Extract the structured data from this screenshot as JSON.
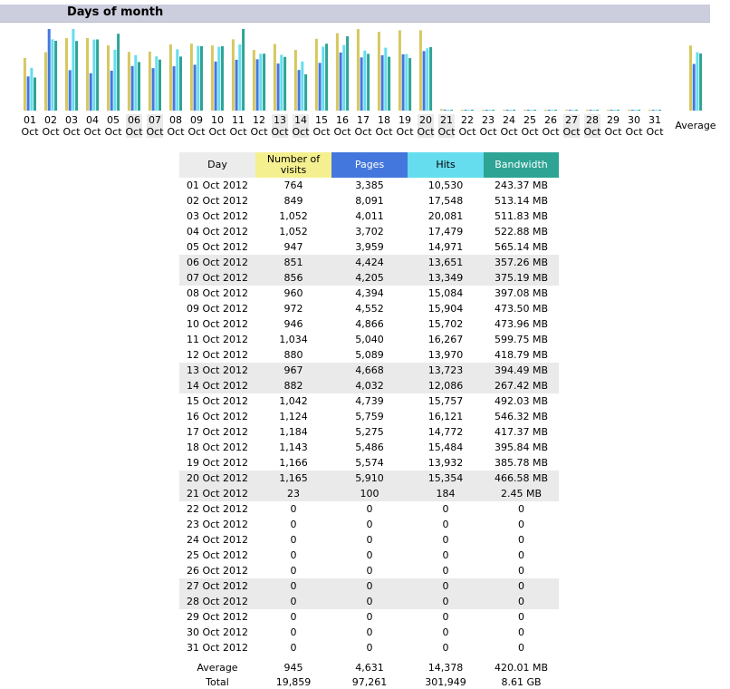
{
  "section": {
    "title": "Days of month"
  },
  "chart_data": {
    "type": "bar",
    "title": "",
    "categories": [
      "01",
      "02",
      "03",
      "04",
      "05",
      "06",
      "07",
      "08",
      "09",
      "10",
      "11",
      "12",
      "13",
      "14",
      "15",
      "16",
      "17",
      "18",
      "19",
      "20",
      "21",
      "22",
      "23",
      "24",
      "25",
      "26",
      "27",
      "28",
      "29",
      "30",
      "31"
    ],
    "category_sublabel": "Oct",
    "weekend_days": [
      "06",
      "07",
      "13",
      "14",
      "20",
      "21",
      "27",
      "28"
    ],
    "average_label": "Average",
    "series": [
      {
        "key": "visits",
        "color": "#d6c860",
        "values": [
          764,
          849,
          1052,
          1052,
          947,
          851,
          856,
          960,
          972,
          946,
          1034,
          880,
          967,
          882,
          1042,
          1124,
          1184,
          1143,
          1166,
          1165,
          23,
          0,
          0,
          0,
          0,
          0,
          0,
          0,
          0,
          0,
          0
        ],
        "average": 945
      },
      {
        "key": "pages",
        "color": "#4477dd",
        "values": [
          3385,
          8091,
          4011,
          3702,
          3959,
          4424,
          4205,
          4394,
          4552,
          4866,
          5040,
          5089,
          4668,
          4032,
          4739,
          5759,
          5275,
          5486,
          5574,
          5910,
          100,
          0,
          0,
          0,
          0,
          0,
          0,
          0,
          0,
          0,
          0
        ],
        "average": 4631
      },
      {
        "key": "hits",
        "color": "#66ddee",
        "values": [
          10530,
          17548,
          20081,
          17479,
          14971,
          13651,
          13349,
          15084,
          15904,
          15702,
          16267,
          13970,
          13723,
          12086,
          15757,
          16121,
          14772,
          15484,
          13932,
          15354,
          184,
          0,
          0,
          0,
          0,
          0,
          0,
          0,
          0,
          0,
          0
        ],
        "average": 14378
      },
      {
        "key": "bandwidth",
        "color": "#2ea495",
        "values": [
          243.37,
          513.14,
          511.83,
          522.88,
          565.14,
          357.26,
          375.19,
          397.08,
          473.5,
          473.96,
          599.75,
          418.79,
          394.49,
          267.42,
          492.03,
          546.32,
          417.37,
          395.84,
          385.78,
          466.58,
          2.45,
          0,
          0,
          0,
          0,
          0,
          0,
          0,
          0,
          0,
          0
        ],
        "average": 420.01
      }
    ]
  },
  "table": {
    "headers": {
      "day": "Day",
      "visits": "Number of visits",
      "pages": "Pages",
      "hits": "Hits",
      "bandwidth": "Bandwidth"
    },
    "rows": [
      {
        "day": "01 Oct 2012",
        "visits": "764",
        "pages": "3,385",
        "hits": "10,530",
        "bandwidth": "243.37 MB",
        "weekend": false
      },
      {
        "day": "02 Oct 2012",
        "visits": "849",
        "pages": "8,091",
        "hits": "17,548",
        "bandwidth": "513.14 MB",
        "weekend": false
      },
      {
        "day": "03 Oct 2012",
        "visits": "1,052",
        "pages": "4,011",
        "hits": "20,081",
        "bandwidth": "511.83 MB",
        "weekend": false
      },
      {
        "day": "04 Oct 2012",
        "visits": "1,052",
        "pages": "3,702",
        "hits": "17,479",
        "bandwidth": "522.88 MB",
        "weekend": false
      },
      {
        "day": "05 Oct 2012",
        "visits": "947",
        "pages": "3,959",
        "hits": "14,971",
        "bandwidth": "565.14 MB",
        "weekend": false
      },
      {
        "day": "06 Oct 2012",
        "visits": "851",
        "pages": "4,424",
        "hits": "13,651",
        "bandwidth": "357.26 MB",
        "weekend": true
      },
      {
        "day": "07 Oct 2012",
        "visits": "856",
        "pages": "4,205",
        "hits": "13,349",
        "bandwidth": "375.19 MB",
        "weekend": true
      },
      {
        "day": "08 Oct 2012",
        "visits": "960",
        "pages": "4,394",
        "hits": "15,084",
        "bandwidth": "397.08 MB",
        "weekend": false
      },
      {
        "day": "09 Oct 2012",
        "visits": "972",
        "pages": "4,552",
        "hits": "15,904",
        "bandwidth": "473.50 MB",
        "weekend": false
      },
      {
        "day": "10 Oct 2012",
        "visits": "946",
        "pages": "4,866",
        "hits": "15,702",
        "bandwidth": "473.96 MB",
        "weekend": false
      },
      {
        "day": "11 Oct 2012",
        "visits": "1,034",
        "pages": "5,040",
        "hits": "16,267",
        "bandwidth": "599.75 MB",
        "weekend": false
      },
      {
        "day": "12 Oct 2012",
        "visits": "880",
        "pages": "5,089",
        "hits": "13,970",
        "bandwidth": "418.79 MB",
        "weekend": false
      },
      {
        "day": "13 Oct 2012",
        "visits": "967",
        "pages": "4,668",
        "hits": "13,723",
        "bandwidth": "394.49 MB",
        "weekend": true
      },
      {
        "day": "14 Oct 2012",
        "visits": "882",
        "pages": "4,032",
        "hits": "12,086",
        "bandwidth": "267.42 MB",
        "weekend": true
      },
      {
        "day": "15 Oct 2012",
        "visits": "1,042",
        "pages": "4,739",
        "hits": "15,757",
        "bandwidth": "492.03 MB",
        "weekend": false
      },
      {
        "day": "16 Oct 2012",
        "visits": "1,124",
        "pages": "5,759",
        "hits": "16,121",
        "bandwidth": "546.32 MB",
        "weekend": false
      },
      {
        "day": "17 Oct 2012",
        "visits": "1,184",
        "pages": "5,275",
        "hits": "14,772",
        "bandwidth": "417.37 MB",
        "weekend": false
      },
      {
        "day": "18 Oct 2012",
        "visits": "1,143",
        "pages": "5,486",
        "hits": "15,484",
        "bandwidth": "395.84 MB",
        "weekend": false
      },
      {
        "day": "19 Oct 2012",
        "visits": "1,166",
        "pages": "5,574",
        "hits": "13,932",
        "bandwidth": "385.78 MB",
        "weekend": false
      },
      {
        "day": "20 Oct 2012",
        "visits": "1,165",
        "pages": "5,910",
        "hits": "15,354",
        "bandwidth": "466.58 MB",
        "weekend": true
      },
      {
        "day": "21 Oct 2012",
        "visits": "23",
        "pages": "100",
        "hits": "184",
        "bandwidth": "2.45 MB",
        "weekend": true
      },
      {
        "day": "22 Oct 2012",
        "visits": "0",
        "pages": "0",
        "hits": "0",
        "bandwidth": "0",
        "weekend": false
      },
      {
        "day": "23 Oct 2012",
        "visits": "0",
        "pages": "0",
        "hits": "0",
        "bandwidth": "0",
        "weekend": false
      },
      {
        "day": "24 Oct 2012",
        "visits": "0",
        "pages": "0",
        "hits": "0",
        "bandwidth": "0",
        "weekend": false
      },
      {
        "day": "25 Oct 2012",
        "visits": "0",
        "pages": "0",
        "hits": "0",
        "bandwidth": "0",
        "weekend": false
      },
      {
        "day": "26 Oct 2012",
        "visits": "0",
        "pages": "0",
        "hits": "0",
        "bandwidth": "0",
        "weekend": false
      },
      {
        "day": "27 Oct 2012",
        "visits": "0",
        "pages": "0",
        "hits": "0",
        "bandwidth": "0",
        "weekend": true
      },
      {
        "day": "28 Oct 2012",
        "visits": "0",
        "pages": "0",
        "hits": "0",
        "bandwidth": "0",
        "weekend": true
      },
      {
        "day": "29 Oct 2012",
        "visits": "0",
        "pages": "0",
        "hits": "0",
        "bandwidth": "0",
        "weekend": false
      },
      {
        "day": "30 Oct 2012",
        "visits": "0",
        "pages": "0",
        "hits": "0",
        "bandwidth": "0",
        "weekend": false
      },
      {
        "day": "31 Oct 2012",
        "visits": "0",
        "pages": "0",
        "hits": "0",
        "bandwidth": "0",
        "weekend": false
      }
    ],
    "average": {
      "label": "Average",
      "visits": "945",
      "pages": "4,631",
      "hits": "14,378",
      "bandwidth": "420.01 MB"
    },
    "total": {
      "label": "Total",
      "visits": "19,859",
      "pages": "97,261",
      "hits": "301,949",
      "bandwidth": "8.61 GB"
    }
  },
  "colors": {
    "header_bar": "#cccddd",
    "weekend_bg": "#eaeaea",
    "visits": "#f4f090",
    "pages": "#4477dd",
    "hits": "#66ddee",
    "bandwidth": "#2ea495"
  }
}
